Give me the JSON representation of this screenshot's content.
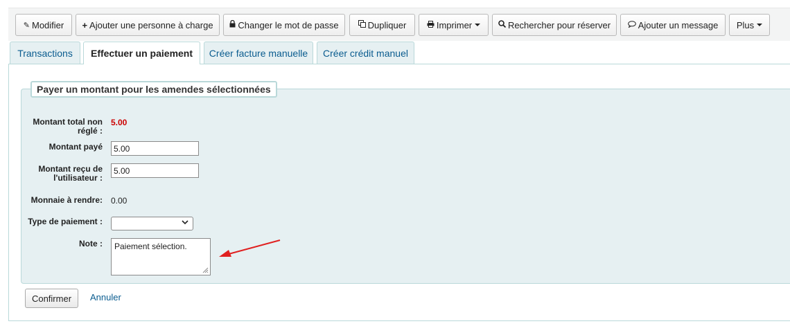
{
  "toolbar": {
    "buttons": [
      {
        "label": "Modifier",
        "icon": "pencil-icon"
      },
      {
        "label": "Ajouter une personne à charge",
        "icon": "plus-icon"
      },
      {
        "label": "Changer le mot de passe",
        "icon": "lock-icon"
      },
      {
        "label": "Dupliquer",
        "icon": "copy-icon"
      },
      {
        "label": "Imprimer",
        "icon": "print-icon",
        "dropdown": true
      },
      {
        "label": "Rechercher pour réserver",
        "icon": "search-icon"
      },
      {
        "label": "Ajouter un message",
        "icon": "comment-icon"
      },
      {
        "label": "Plus",
        "dropdown": true
      }
    ]
  },
  "tabs": [
    {
      "label": "Transactions",
      "active": false
    },
    {
      "label": "Effectuer un paiement",
      "active": true
    },
    {
      "label": "Créer facture manuelle",
      "active": false
    },
    {
      "label": "Créer crédit manuel",
      "active": false
    }
  ],
  "form": {
    "legend": "Payer un montant pour les amendes sélectionnées",
    "total_label_1": "Montant total non",
    "total_label_2": "réglé :",
    "total_value": "5.00",
    "paid_label": "Montant payé",
    "paid_value": "5.00",
    "received_label_1": "Montant reçu de",
    "received_label_2": "l'utilisateur :",
    "received_value": "5.00",
    "change_label": "Monnaie à rendre:",
    "change_value": "0.00",
    "type_label": "Type de paiement :",
    "type_value": "",
    "note_label": "Note :",
    "note_value": "Paiement sélection."
  },
  "actions": {
    "confirm": "Confirmer",
    "cancel": "Annuler"
  },
  "colors": {
    "accent": "#0a5c8f",
    "panel_bg": "#e6f0f2",
    "border": "#b9d8d9",
    "amount_due": "#cc0000",
    "annotation_arrow": "#e02020"
  }
}
